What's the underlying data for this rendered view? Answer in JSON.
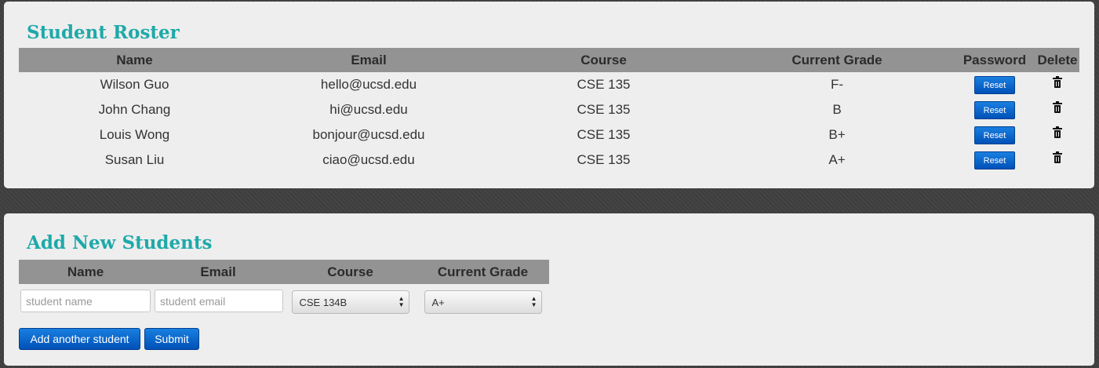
{
  "roster": {
    "title": "Student Roster",
    "columns": [
      "Name",
      "Email",
      "Course",
      "Current Grade",
      "Password",
      "Delete"
    ],
    "rows": [
      {
        "name": "Wilson Guo",
        "email": "hello@ucsd.edu",
        "course": "CSE 135",
        "grade": "F-",
        "reset_label": "Reset"
      },
      {
        "name": "John Chang",
        "email": "hi@ucsd.edu",
        "course": "CSE 135",
        "grade": "B",
        "reset_label": "Reset"
      },
      {
        "name": "Louis Wong",
        "email": "bonjour@ucsd.edu",
        "course": "CSE 135",
        "grade": "B+",
        "reset_label": "Reset"
      },
      {
        "name": "Susan Liu",
        "email": "ciao@ucsd.edu",
        "course": "CSE 135",
        "grade": "A+",
        "reset_label": "Reset"
      }
    ],
    "delete_icon": "trash-icon"
  },
  "add_students": {
    "title": "Add New Students",
    "columns": [
      "Name",
      "Email",
      "Course",
      "Current Grade"
    ],
    "name_placeholder": "student name",
    "email_placeholder": "student email",
    "course_selected": "CSE 134B",
    "grade_selected": "A+",
    "add_another_label": "Add another student",
    "submit_label": "Submit"
  },
  "colors": {
    "title": "#1fa9a9",
    "header_bg": "#939393",
    "button_blue": "#0a66d0",
    "panel_bg": "#eeeeee"
  }
}
